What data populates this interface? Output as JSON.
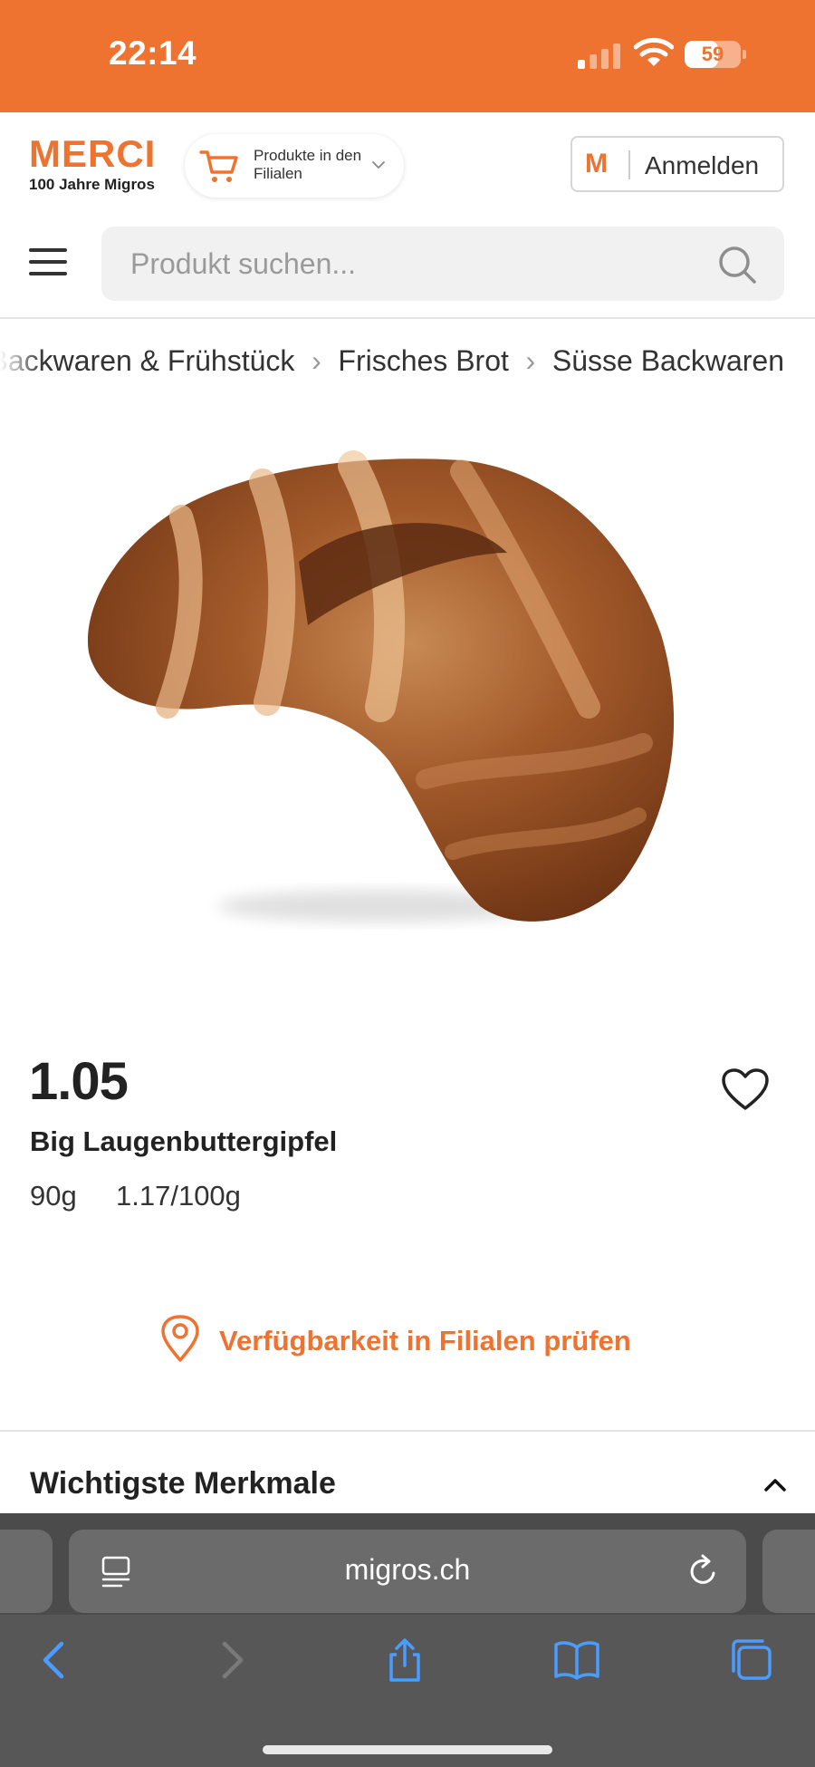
{
  "status_bar": {
    "time": "22:14",
    "battery_percent": "59",
    "signal_bars_active": 1,
    "signal_bars_total": 4
  },
  "header": {
    "logo_title": "MERCI",
    "logo_subtitle": "100 Jahre Migros",
    "store_selector_label": "Produkte in den Filialen",
    "login_logo": "M",
    "login_label": "Anmelden",
    "search_placeholder": "Produkt suchen..."
  },
  "breadcrumb": [
    "Brot, Backwaren & Frühstück",
    "Frisches Brot",
    "Süsse Backwaren"
  ],
  "product": {
    "price": "1.05",
    "name": "Big Laugenbuttergipfel",
    "weight": "90g",
    "unit_price": "1.17/100g",
    "availability_label": "Verfügbarkeit in Filialen prüfen",
    "section_title": "Wichtigste Merkmale",
    "image_subject": "croissant"
  },
  "browser": {
    "domain": "migros.ch"
  },
  "icons": {
    "cart": "cart-icon",
    "chevron": "chevron-down-icon",
    "menu": "hamburger-menu-icon",
    "search": "search-icon",
    "favorite": "heart-icon",
    "location": "location-pin-icon",
    "collapse": "chevron-up-icon",
    "reader": "reader-mode-icon",
    "reload": "reload-icon",
    "back": "back-icon",
    "forward": "forward-icon",
    "share": "share-icon",
    "bookmarks": "bookmarks-icon",
    "tabs": "tabs-icon"
  },
  "colors": {
    "brand": "#ee7330",
    "ios_blue": "#4a9cff"
  }
}
